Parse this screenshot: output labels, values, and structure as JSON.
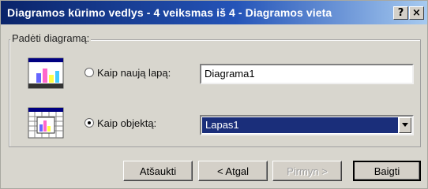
{
  "window": {
    "title": "Diagramos kūrimo vedlys - 4 veiksmas iš 4 - Diagramos vieta",
    "help_glyph": "?",
    "close_glyph": "×"
  },
  "group": {
    "label": "Padėti diagramą:"
  },
  "options": [
    {
      "label": "Kaip naują lapą:",
      "value": "Diagrama1",
      "selected": false,
      "icon": "new-sheet-chart-icon"
    },
    {
      "label": "Kaip objektą:",
      "value": "Lapas1",
      "selected": true,
      "icon": "embedded-object-chart-icon"
    }
  ],
  "buttons": {
    "cancel": "Atšaukti",
    "back": "< Atgal",
    "next": "Pirmyn >",
    "finish": "Baigti"
  },
  "colors": {
    "title_start": "#0a246a",
    "title_end": "#a6caf0",
    "selection": "#1a2e7a"
  }
}
